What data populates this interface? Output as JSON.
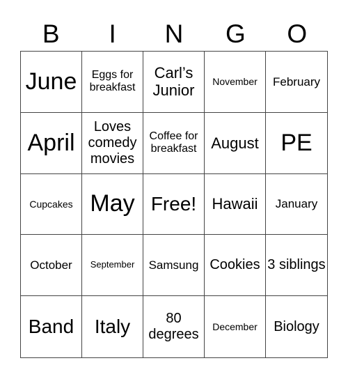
{
  "header": [
    "B",
    "I",
    "N",
    "G",
    "O"
  ],
  "cells": [
    {
      "text": "June",
      "size": "s-xl"
    },
    {
      "text": "Eggs for breakfast",
      "size": "s-s"
    },
    {
      "text": "Carl’s Junior",
      "size": "s-ml"
    },
    {
      "text": "November",
      "size": "s-xs"
    },
    {
      "text": "February",
      "size": "s-sm"
    },
    {
      "text": "April",
      "size": "s-xl"
    },
    {
      "text": "Loves comedy movies",
      "size": "s-m"
    },
    {
      "text": "Coffee for breakfast",
      "size": "s-s"
    },
    {
      "text": "August",
      "size": "s-ml"
    },
    {
      "text": "PE",
      "size": "s-xl"
    },
    {
      "text": "Cupcakes",
      "size": "s-xs"
    },
    {
      "text": "May",
      "size": "s-xl"
    },
    {
      "text": "Free!",
      "size": "s-l"
    },
    {
      "text": "Hawaii",
      "size": "s-ml"
    },
    {
      "text": "January",
      "size": "s-sm"
    },
    {
      "text": "October",
      "size": "s-sm"
    },
    {
      "text": "September",
      "size": "s-xxs"
    },
    {
      "text": "Samsung",
      "size": "s-sm"
    },
    {
      "text": "Cookies",
      "size": "s-m"
    },
    {
      "text": "3 siblings",
      "size": "s-m"
    },
    {
      "text": "Band",
      "size": "s-l"
    },
    {
      "text": "Italy",
      "size": "s-l"
    },
    {
      "text": "80 degrees",
      "size": "s-m"
    },
    {
      "text": "December",
      "size": "s-xs"
    },
    {
      "text": "Biology",
      "size": "s-m"
    }
  ]
}
